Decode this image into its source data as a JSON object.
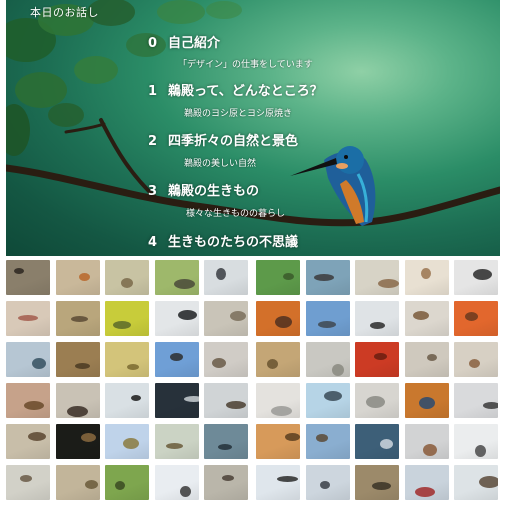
{
  "slide": {
    "title": "本日のお話し",
    "agenda": [
      {
        "num": "0",
        "heading": "自己紹介",
        "sub": "「デザイン」の仕事をしています"
      },
      {
        "num": "1",
        "heading": "鵜殿って、どんなところ？",
        "sub": "鵜殿のヨシ原とヨシ原焼き"
      },
      {
        "num": "2",
        "heading": "四季折々の自然と景色",
        "sub": "鵜殿の美しい自然"
      },
      {
        "num": "3",
        "heading": "鵜殿の生きもの",
        "sub": "様々な生きものの暮らし"
      },
      {
        "num": "4",
        "heading": "生きものたちの不思議",
        "sub": ""
      }
    ],
    "illustration": "kingfisher-on-branch"
  },
  "gallery": {
    "columns": 10,
    "rows": 6,
    "thumbnails": [
      {
        "bg": "#8a7f6b",
        "spot": "#2b2620"
      },
      {
        "bg": "#c9b89a",
        "spot": "#b8662a"
      },
      {
        "bg": "#c8c3a3",
        "spot": "#7a6a4a"
      },
      {
        "bg": "#9eb86b",
        "spot": "#4a4a3a"
      },
      {
        "bg": "#d8dde0",
        "spot": "#3a3d42"
      },
      {
        "bg": "#5d9a4a",
        "spot": "#3a5a2a"
      },
      {
        "bg": "#7ea3b8",
        "spot": "#3b3b3b"
      },
      {
        "bg": "#d7d3c6",
        "spot": "#8a6a4a"
      },
      {
        "bg": "#e8e0d2",
        "spot": "#9a7450"
      },
      {
        "bg": "#e5e5e5",
        "spot": "#2a2a2a"
      },
      {
        "bg": "#d8c9b8",
        "spot": "#a35c4c"
      },
      {
        "bg": "#b9a67c",
        "spot": "#5a4a35"
      },
      {
        "bg": "#c8cc3a",
        "spot": "#5c6a2a"
      },
      {
        "bg": "#e3e6e8",
        "spot": "#1f2022"
      },
      {
        "bg": "#c9c4b8",
        "spot": "#7a6e5a"
      },
      {
        "bg": "#d3702a",
        "spot": "#503020"
      },
      {
        "bg": "#6f9ed0",
        "spot": "#404850"
      },
      {
        "bg": "#dfe3e6",
        "spot": "#2b2b2b"
      },
      {
        "bg": "#dcd7ce",
        "spot": "#7a5a3a"
      },
      {
        "bg": "#e2672d",
        "spot": "#6a3a1e"
      },
      {
        "bg": "#b6c6d3",
        "spot": "#355060"
      },
      {
        "bg": "#9b7e52",
        "spot": "#4a3a22"
      },
      {
        "bg": "#d3c47a",
        "spot": "#7a6a30"
      },
      {
        "bg": "#6f9fd6",
        "spot": "#2e2e2e"
      },
      {
        "bg": "#d0ccc6",
        "spot": "#6a5a48"
      },
      {
        "bg": "#c4a676",
        "spot": "#6a5430"
      },
      {
        "bg": "#c9c8c2",
        "spot": "#8a8a80"
      },
      {
        "bg": "#cc3b24",
        "spot": "#6a1e10"
      },
      {
        "bg": "#cfc9be",
        "spot": "#6a5a48"
      },
      {
        "bg": "#d7d0c4",
        "spot": "#8a6040"
      },
      {
        "bg": "#c6a28a",
        "spot": "#6a4a2a"
      },
      {
        "bg": "#c9c2b5",
        "spot": "#3a2e26"
      },
      {
        "bg": "#d9e0e4",
        "spot": "#1a1a1a"
      },
      {
        "bg": "#27313a",
        "spot": "#c9cfd4"
      },
      {
        "bg": "#d0d4d6",
        "spot": "#4a3e30"
      },
      {
        "bg": "#e4e2de",
        "spot": "#9a9a96"
      },
      {
        "bg": "#b6d4e6",
        "spot": "#3a4a56"
      },
      {
        "bg": "#d7d5d0",
        "spot": "#8a8a84"
      },
      {
        "bg": "#c9782e",
        "spot": "#2a4a70"
      },
      {
        "bg": "#d9dadc",
        "spot": "#3a3a3a"
      },
      {
        "bg": "#c8bea9",
        "spot": "#5a4630"
      },
      {
        "bg": "#1b1c18",
        "spot": "#8a6a40"
      },
      {
        "bg": "#bfd3ea",
        "spot": "#8a7a40"
      },
      {
        "bg": "#cbd3c4",
        "spot": "#6a5a3a"
      },
      {
        "bg": "#6e8a98",
        "spot": "#233038"
      },
      {
        "bg": "#d79a5a",
        "spot": "#5a3e20"
      },
      {
        "bg": "#8aaed0",
        "spot": "#5a4a36"
      },
      {
        "bg": "#3d5f78",
        "spot": "#ced6de"
      },
      {
        "bg": "#d2d3d4",
        "spot": "#8a5a3a"
      },
      {
        "bg": "#ebedee",
        "spot": "#4a4a4a"
      },
      {
        "bg": "#d2d1c8",
        "spot": "#6a5a46"
      },
      {
        "bg": "#c2b59a",
        "spot": "#6a5a3a"
      },
      {
        "bg": "#7ea64e",
        "spot": "#3a4a22"
      },
      {
        "bg": "#e9edf1",
        "spot": "#3a3a3a"
      },
      {
        "bg": "#bab6aa",
        "spot": "#4a4036"
      },
      {
        "bg": "#dfe6ec",
        "spot": "#2a2a2a"
      },
      {
        "bg": "#cdd6de",
        "spot": "#3a4048"
      },
      {
        "bg": "#9c8a6a",
        "spot": "#3a3226"
      },
      {
        "bg": "#c9d3dc",
        "spot": "#a02a2a"
      },
      {
        "bg": "#dde3e6",
        "spot": "#5a4a3a"
      }
    ]
  }
}
